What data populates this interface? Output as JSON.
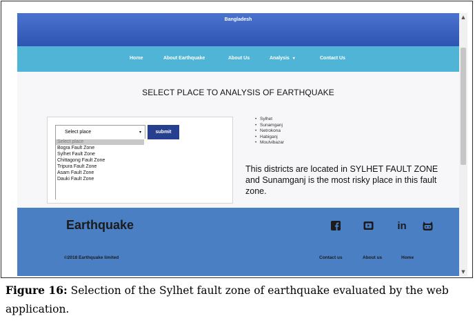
{
  "header": {
    "title": "Bangladesh"
  },
  "nav": {
    "items": [
      "Home",
      "About Earthquake",
      "About Us",
      "Analysis",
      "Contact Us"
    ],
    "dropdown_caret": "▾"
  },
  "main": {
    "heading": "SELECT PLACE TO ANALYSIS OF EARTHQUAKE",
    "select": {
      "value": "Select place",
      "caret": "▾"
    },
    "submit_label": "submit",
    "options": [
      "Select place",
      "Bogra Fault Zone",
      "Sylhet Fault Zone",
      "Chittagong Fault Zone",
      "Tripura Fault Zone",
      "Asam Fault Zone",
      "Dauki Fault Zone"
    ],
    "districts": [
      "Sylhet",
      "Sunamganj",
      "Netrokona",
      "Habiganj",
      "Moulvibazar"
    ],
    "info_text": "This districts are located in SYLHET FAULT ZONE and Sunamganj is the most risky place in this fault zone."
  },
  "footer": {
    "brand": "Earthquake",
    "social_icons": [
      "facebook-icon",
      "youtube-icon",
      "linkedin-icon",
      "github-icon"
    ],
    "linkedin_text": "in",
    "copyright": "©2018 Earthquake limited",
    "links": [
      "Contact us",
      "About us",
      "Home"
    ]
  },
  "caption": {
    "label": "Figure 16:",
    "text": " Selection of the Sylhet fault zone of earthquake evaluated by the web application."
  },
  "colors": {
    "topbar": "#3a62c2",
    "navbar": "#4fb4d6",
    "submit": "#273f8f",
    "footer": "#4b7fc4"
  }
}
